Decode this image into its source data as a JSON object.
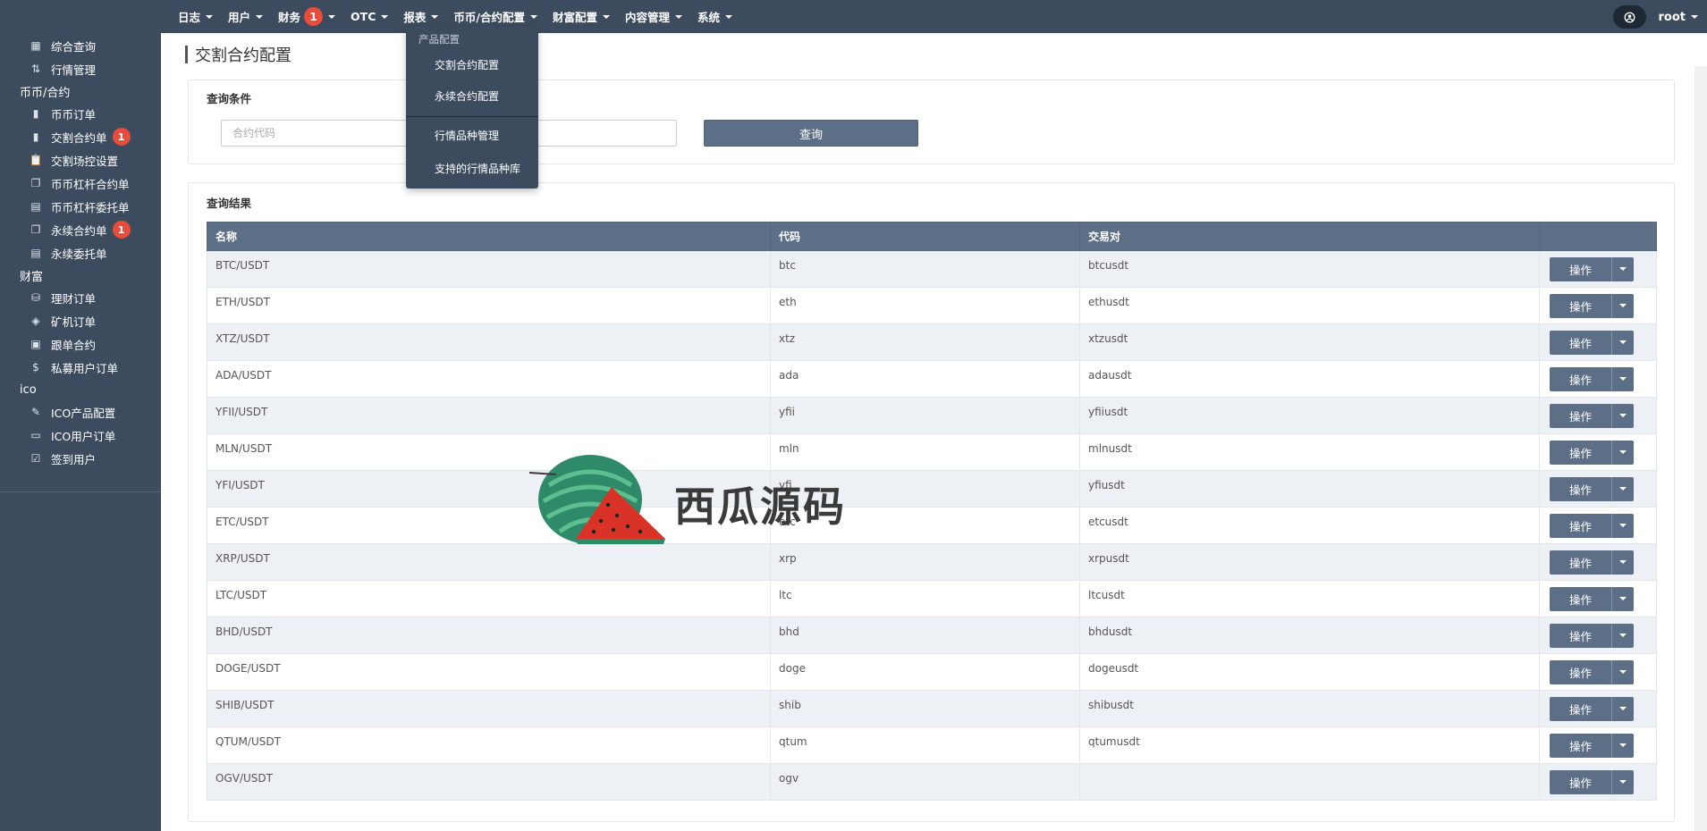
{
  "sidebar": {
    "items": [
      {
        "icon": "dashboard-icon",
        "label": "综合查询",
        "type": "item"
      },
      {
        "icon": "sort-icon",
        "label": "行情管理",
        "type": "item"
      },
      {
        "label": "币币/合约",
        "type": "head"
      },
      {
        "icon": "bookmark-icon",
        "label": "币币订单",
        "type": "item"
      },
      {
        "icon": "bookmark-icon",
        "label": "交割合约单",
        "type": "item",
        "badge": "1"
      },
      {
        "icon": "clipboard-icon",
        "label": "交割场控设置",
        "type": "item"
      },
      {
        "icon": "copy-icon",
        "label": "币币杠杆合约单",
        "type": "item"
      },
      {
        "icon": "calendar-clock-icon",
        "label": "币币杠杆委托单",
        "type": "item"
      },
      {
        "icon": "copy-icon",
        "label": "永续合约单",
        "type": "item",
        "badge": "1"
      },
      {
        "icon": "calendar-clock-icon",
        "label": "永续委托单",
        "type": "item"
      },
      {
        "label": "财富",
        "type": "head"
      },
      {
        "icon": "coins-icon",
        "label": "理财订单",
        "type": "item"
      },
      {
        "icon": "layers-icon",
        "label": "矿机订单",
        "type": "item"
      },
      {
        "icon": "calendar-plus-icon",
        "label": "跟单合约",
        "type": "item"
      },
      {
        "icon": "dollar-icon",
        "label": "私募用户订单",
        "type": "item"
      },
      {
        "label": "ico",
        "type": "head"
      },
      {
        "icon": "edit-doc-icon",
        "label": "ICO产品配置",
        "type": "item"
      },
      {
        "icon": "monitor-icon",
        "label": "ICO用户订单",
        "type": "item"
      },
      {
        "icon": "checkbox-edit-icon",
        "label": "签到用户",
        "type": "item"
      }
    ]
  },
  "topnav": {
    "items": [
      {
        "label": "日志"
      },
      {
        "label": "用户"
      },
      {
        "label": "财务",
        "badge": "1"
      },
      {
        "label": "OTC"
      },
      {
        "label": "报表"
      },
      {
        "label": "币币/合约配置"
      },
      {
        "label": "财富配置"
      },
      {
        "label": "内容管理"
      },
      {
        "label": "系统"
      }
    ],
    "user": "root"
  },
  "dropdown": {
    "header": "产品配置",
    "items": [
      "交割合约配置",
      "永续合约配置",
      "行情品种管理",
      "支持的行情品种库"
    ]
  },
  "page": {
    "title": "交割合约配置",
    "search": {
      "title": "查询条件",
      "placeholder": "合约代码",
      "button": "查询"
    },
    "results": {
      "title": "查询结果",
      "columns": [
        "名称",
        "代码",
        "交易对",
        ""
      ],
      "action_label": "操作",
      "rows": [
        [
          "BTC/USDT",
          "btc",
          "btcusdt"
        ],
        [
          "ETH/USDT",
          "eth",
          "ethusdt"
        ],
        [
          "XTZ/USDT",
          "xtz",
          "xtzusdt"
        ],
        [
          "ADA/USDT",
          "ada",
          "adausdt"
        ],
        [
          "YFII/USDT",
          "yfii",
          "yfiiusdt"
        ],
        [
          "MLN/USDT",
          "mln",
          "mlnusdt"
        ],
        [
          "YFI/USDT",
          "yfi",
          "yfiusdt"
        ],
        [
          "ETC/USDT",
          "etc",
          "etcusdt"
        ],
        [
          "XRP/USDT",
          "xrp",
          "xrpusdt"
        ],
        [
          "LTC/USDT",
          "ltc",
          "ltcusdt"
        ],
        [
          "BHD/USDT",
          "bhd",
          "bhdusdt"
        ],
        [
          "DOGE/USDT",
          "doge",
          "dogeusdt"
        ],
        [
          "SHIB/USDT",
          "shib",
          "shibusdt"
        ],
        [
          "QTUM/USDT",
          "qtum",
          "qtumusdt"
        ],
        [
          "OGV/USDT",
          "ogv",
          ""
        ]
      ]
    }
  },
  "watermark": {
    "text": "西瓜源码"
  }
}
